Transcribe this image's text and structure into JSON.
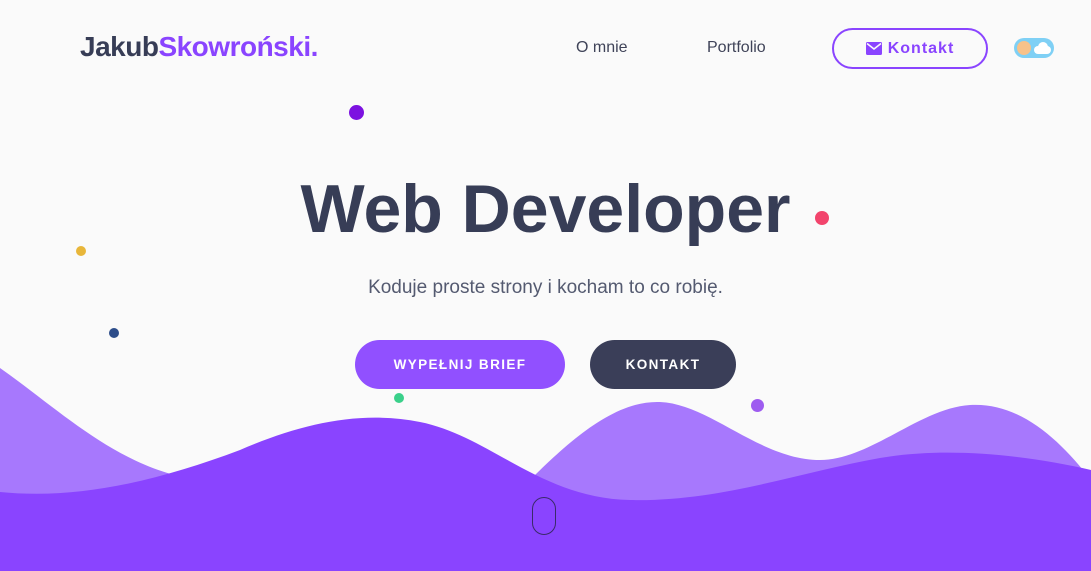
{
  "header": {
    "logo_first": "Jakub",
    "logo_last": "Skowroński",
    "logo_dot": ".",
    "nav": {
      "about": "O mnie",
      "portfolio": "Portfolio",
      "contact": "Kontakt"
    },
    "theme_toggle": {
      "state": "light",
      "icons": [
        "sun-icon",
        "cloud-icon"
      ]
    }
  },
  "hero": {
    "title": "Web Developer",
    "subtitle": "Koduje proste strony i kocham to co robię.",
    "primary_button": "WYPEŁNIJ BRIEF",
    "secondary_button": "KONTAKT"
  },
  "colors": {
    "accent": "#8a44ff",
    "dark": "#373d56",
    "wave_light": "#a778fd",
    "wave_dark": "#8a44ff",
    "dot_red": "#f2446c",
    "dot_purple": "#7c12e0",
    "dot_yellow": "#e8b63a",
    "dot_navy": "#2d4d8a",
    "dot_green": "#3ad08a",
    "dot_violet": "#9e5cf0"
  },
  "icons": {
    "contact": "envelope-icon",
    "scroll": "mouse-scroll-icon"
  }
}
